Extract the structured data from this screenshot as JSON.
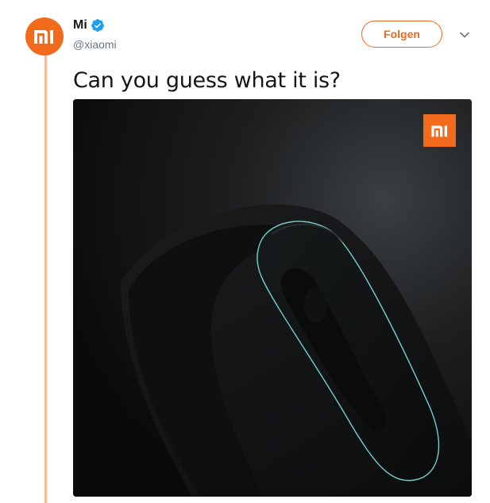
{
  "account": {
    "display_name": "Mi",
    "handle": "@xiaomi",
    "verified": true,
    "avatar_icon": "mi-logo-icon",
    "brand_color": "#f26a1b"
  },
  "actions": {
    "follow_label": "Folgen",
    "more_icon": "chevron-down-icon"
  },
  "tweet": {
    "text": "Can you guess what it is?"
  },
  "media": {
    "logo_icon": "mi-logo-icon",
    "accent_color": "#7fe6e0"
  },
  "thread_line_color": "#f9b89a"
}
